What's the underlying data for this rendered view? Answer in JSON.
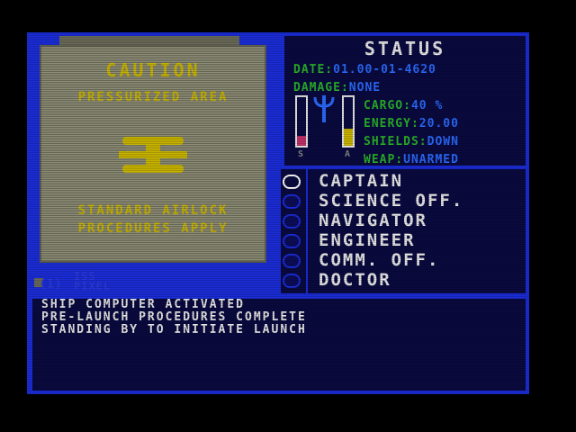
{
  "airlock": {
    "caution": "CAUTION",
    "area": "PRESSURIZED AREA",
    "line1": "STANDARD AIRLOCK",
    "line2": "PROCEDURES APPLY"
  },
  "status": {
    "title": "STATUS",
    "date_label": "DATE:",
    "date_value": "01.00-01-4620",
    "damage_label": "DAMAGE:",
    "damage_value": "NONE",
    "cargo_label": "CARGO:",
    "cargo_value": "40 %",
    "energy_label": "ENERGY:",
    "energy_value": "20.00",
    "shields_label": "SHIELDS:",
    "shields_value": "DOWN",
    "weap_label": "WEAP:",
    "weap_value": "UNARMED",
    "gauge_s_label": "S",
    "gauge_a_label": "A",
    "gauge_s_level": 0.2,
    "gauge_a_level": 0.35
  },
  "logo": {
    "line1": "ISS",
    "line2": "PIXEL"
  },
  "crew": [
    {
      "label": "CAPTAIN",
      "selected": true
    },
    {
      "label": "SCIENCE OFF.",
      "selected": false
    },
    {
      "label": "NAVIGATOR",
      "selected": false
    },
    {
      "label": "ENGINEER",
      "selected": false
    },
    {
      "label": "COMM. OFF.",
      "selected": false
    },
    {
      "label": "DOCTOR",
      "selected": false
    }
  ],
  "messages": [
    "SHIP COMPUTER ACTIVATED",
    "PRE-LAUNCH PROCEDURES COMPLETE",
    "STANDING BY TO INITIATE LAUNCH"
  ],
  "colors": {
    "frame": "#1a2dd8",
    "panel": "#0a0a40",
    "label_green": "#28b428",
    "value_blue": "#2a6bff",
    "caution_yellow": "#c8b400",
    "text_white": "#e8e8e8"
  }
}
